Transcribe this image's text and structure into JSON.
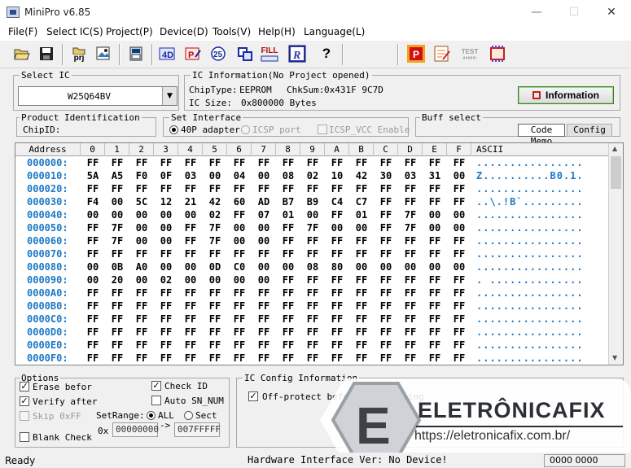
{
  "window": {
    "title": "MiniPro v6.85",
    "minimize": "—",
    "maximize": "☐",
    "close": "✕"
  },
  "menu": [
    "File(F)",
    "Select IC(S)",
    "Project(P)",
    "Device(D)",
    "Tools(V)",
    "Help(H)",
    "Language(L)"
  ],
  "toolbar": {
    "prj": "prj",
    "d": "D",
    "p": "P",
    "test": "TEST",
    "fill": "FILL",
    "r": "R",
    "help": "?"
  },
  "select_ic": {
    "title": "Select IC",
    "chip": "W25Q64BV"
  },
  "ic_info": {
    "title": "IC Information(No Project opened)",
    "chiptype_label": "ChipType:",
    "chiptype": "EEPROM",
    "chksum_label": "ChkSum:",
    "chksum": "0x431F 9C7D",
    "size_label": "IC Size:",
    "size": "0x800000 Bytes",
    "info_button": "Information"
  },
  "product_id": {
    "title": "Product Identification",
    "chipid_label": "ChipID:"
  },
  "set_interface": {
    "title": "Set Interface",
    "opt1": "40P adapter",
    "opt2": "ICSP port",
    "opt3": "ICSP_VCC Enable"
  },
  "buff_select": {
    "title": "Buff select",
    "code": "Code",
    "memo": "Memo",
    "config": "Config"
  },
  "hex": {
    "header_address": "Address",
    "columns": [
      "0",
      "1",
      "2",
      "3",
      "4",
      "5",
      "6",
      "7",
      "8",
      "9",
      "A",
      "B",
      "C",
      "D",
      "E",
      "F"
    ],
    "header_ascii": "ASCII",
    "rows": [
      {
        "addr": "000000:",
        "bytes": [
          "FF",
          "FF",
          "FF",
          "FF",
          "FF",
          "FF",
          "FF",
          "FF",
          "FF",
          "FF",
          "FF",
          "FF",
          "FF",
          "FF",
          "FF",
          "FF"
        ],
        "ascii": "................"
      },
      {
        "addr": "000010:",
        "bytes": [
          "5A",
          "A5",
          "F0",
          "0F",
          "03",
          "00",
          "04",
          "00",
          "08",
          "02",
          "10",
          "42",
          "30",
          "03",
          "31",
          "00"
        ],
        "ascii": "Z..........B0.1."
      },
      {
        "addr": "000020:",
        "bytes": [
          "FF",
          "FF",
          "FF",
          "FF",
          "FF",
          "FF",
          "FF",
          "FF",
          "FF",
          "FF",
          "FF",
          "FF",
          "FF",
          "FF",
          "FF",
          "FF"
        ],
        "ascii": "................"
      },
      {
        "addr": "000030:",
        "bytes": [
          "F4",
          "00",
          "5C",
          "12",
          "21",
          "42",
          "60",
          "AD",
          "B7",
          "B9",
          "C4",
          "C7",
          "FF",
          "FF",
          "FF",
          "FF"
        ],
        "ascii": "..\\.!B`........."
      },
      {
        "addr": "000040:",
        "bytes": [
          "00",
          "00",
          "00",
          "00",
          "00",
          "02",
          "FF",
          "07",
          "01",
          "00",
          "FF",
          "01",
          "FF",
          "7F",
          "00",
          "00"
        ],
        "ascii": "................"
      },
      {
        "addr": "000050:",
        "bytes": [
          "FF",
          "7F",
          "00",
          "00",
          "FF",
          "7F",
          "00",
          "00",
          "FF",
          "7F",
          "00",
          "00",
          "FF",
          "7F",
          "00",
          "00"
        ],
        "ascii": "................"
      },
      {
        "addr": "000060:",
        "bytes": [
          "FF",
          "7F",
          "00",
          "00",
          "FF",
          "7F",
          "00",
          "00",
          "FF",
          "FF",
          "FF",
          "FF",
          "FF",
          "FF",
          "FF",
          "FF"
        ],
        "ascii": "................"
      },
      {
        "addr": "000070:",
        "bytes": [
          "FF",
          "FF",
          "FF",
          "FF",
          "FF",
          "FF",
          "FF",
          "FF",
          "FF",
          "FF",
          "FF",
          "FF",
          "FF",
          "FF",
          "FF",
          "FF"
        ],
        "ascii": "................"
      },
      {
        "addr": "000080:",
        "bytes": [
          "00",
          "0B",
          "A0",
          "00",
          "00",
          "0D",
          "C0",
          "00",
          "00",
          "08",
          "80",
          "00",
          "00",
          "00",
          "00",
          "00"
        ],
        "ascii": "................"
      },
      {
        "addr": "000090:",
        "bytes": [
          "00",
          "20",
          "00",
          "02",
          "00",
          "00",
          "00",
          "00",
          "FF",
          "FF",
          "FF",
          "FF",
          "FF",
          "FF",
          "FF",
          "FF"
        ],
        "ascii": ". .............."
      },
      {
        "addr": "0000A0:",
        "bytes": [
          "FF",
          "FF",
          "FF",
          "FF",
          "FF",
          "FF",
          "FF",
          "FF",
          "FF",
          "FF",
          "FF",
          "FF",
          "FF",
          "FF",
          "FF",
          "FF"
        ],
        "ascii": "................"
      },
      {
        "addr": "0000B0:",
        "bytes": [
          "FF",
          "FF",
          "FF",
          "FF",
          "FF",
          "FF",
          "FF",
          "FF",
          "FF",
          "FF",
          "FF",
          "FF",
          "FF",
          "FF",
          "FF",
          "FF"
        ],
        "ascii": "................"
      },
      {
        "addr": "0000C0:",
        "bytes": [
          "FF",
          "FF",
          "FF",
          "FF",
          "FF",
          "FF",
          "FF",
          "FF",
          "FF",
          "FF",
          "FF",
          "FF",
          "FF",
          "FF",
          "FF",
          "FF"
        ],
        "ascii": "................"
      },
      {
        "addr": "0000D0:",
        "bytes": [
          "FF",
          "FF",
          "FF",
          "FF",
          "FF",
          "FF",
          "FF",
          "FF",
          "FF",
          "FF",
          "FF",
          "FF",
          "FF",
          "FF",
          "FF",
          "FF"
        ],
        "ascii": "................"
      },
      {
        "addr": "0000E0:",
        "bytes": [
          "FF",
          "FF",
          "FF",
          "FF",
          "FF",
          "FF",
          "FF",
          "FF",
          "FF",
          "FF",
          "FF",
          "FF",
          "FF",
          "FF",
          "FF",
          "FF"
        ],
        "ascii": "................"
      },
      {
        "addr": "0000F0:",
        "bytes": [
          "FF",
          "FF",
          "FF",
          "FF",
          "FF",
          "FF",
          "FF",
          "FF",
          "FF",
          "FF",
          "FF",
          "FF",
          "FF",
          "FF",
          "FF",
          "FF"
        ],
        "ascii": "................"
      }
    ]
  },
  "options": {
    "title": "Options",
    "erase": "Erase befor",
    "verify": "Verify after",
    "skip": "Skip 0xFF",
    "blank": "Blank Check",
    "check_id": "Check ID",
    "auto_sn": "Auto SN_NUM",
    "setrange": "SetRange:",
    "all": "ALL",
    "sect": "Sect",
    "ox": "0x",
    "from": "00000000",
    "arrow": "->",
    "to": "007FFFFF"
  },
  "ic_config": {
    "title": "IC Config Information",
    "offprotect": "Off-protect before programming"
  },
  "watermark": {
    "brand": "ELETRÔNICAFIX",
    "url": "https://eletronicafix.com.br/",
    "letter": "E"
  },
  "status": {
    "left": "Ready",
    "middle": "Hardware Interface Ver: No Device!",
    "right": "0000 0000"
  }
}
